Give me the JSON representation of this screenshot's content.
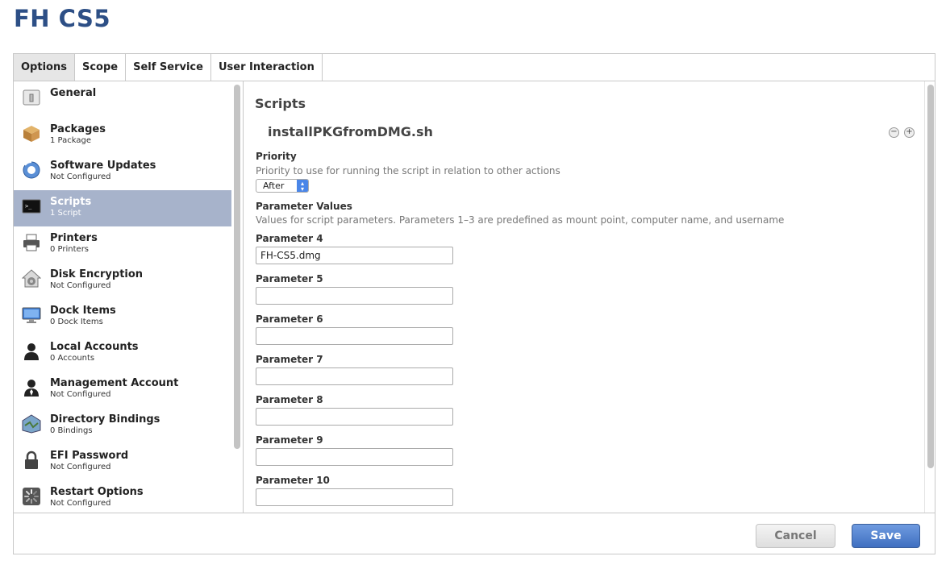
{
  "page": {
    "title": "FH CS5"
  },
  "tabs": [
    {
      "label": "Options",
      "active": true
    },
    {
      "label": "Scope"
    },
    {
      "label": "Self Service"
    },
    {
      "label": "User Interaction"
    }
  ],
  "sidebar": {
    "items": [
      {
        "name": "General",
        "sub": "",
        "icon": "general-icon"
      },
      {
        "name": "Packages",
        "sub": "1 Package",
        "icon": "package-icon"
      },
      {
        "name": "Software Updates",
        "sub": "Not Configured",
        "icon": "software-update-icon"
      },
      {
        "name": "Scripts",
        "sub": "1 Script",
        "icon": "terminal-icon",
        "active": true
      },
      {
        "name": "Printers",
        "sub": "0 Printers",
        "icon": "printer-icon"
      },
      {
        "name": "Disk Encryption",
        "sub": "Not Configured",
        "icon": "disk-encryption-icon"
      },
      {
        "name": "Dock Items",
        "sub": "0 Dock Items",
        "icon": "monitor-icon"
      },
      {
        "name": "Local Accounts",
        "sub": "0 Accounts",
        "icon": "user-icon"
      },
      {
        "name": "Management Account",
        "sub": "Not Configured",
        "icon": "admin-user-icon"
      },
      {
        "name": "Directory Bindings",
        "sub": "0 Bindings",
        "icon": "directory-icon"
      },
      {
        "name": "EFI Password",
        "sub": "Not Configured",
        "icon": "lock-icon"
      },
      {
        "name": "Restart Options",
        "sub": "Not Configured",
        "icon": "restart-icon"
      }
    ]
  },
  "main": {
    "section_title": "Scripts",
    "script_name": "installPKGfromDMG.sh",
    "priority": {
      "label": "Priority",
      "hint": "Priority to use for running the script in relation to other actions",
      "value": "After"
    },
    "parameters": {
      "label": "Parameter Values",
      "hint": "Values for script parameters. Parameters 1–3 are predefined as mount point, computer name, and username",
      "fields": [
        {
          "label": "Parameter 4",
          "value": "FH-CS5.dmg"
        },
        {
          "label": "Parameter 5",
          "value": ""
        },
        {
          "label": "Parameter 6",
          "value": ""
        },
        {
          "label": "Parameter 7",
          "value": ""
        },
        {
          "label": "Parameter 8",
          "value": ""
        },
        {
          "label": "Parameter 9",
          "value": ""
        },
        {
          "label": "Parameter 10",
          "value": ""
        }
      ]
    }
  },
  "footer": {
    "cancel_label": "Cancel",
    "save_label": "Save"
  },
  "colors": {
    "title": "#2d4f86",
    "active_item": "#a7b3cb",
    "save_button": "#4f7fcf"
  }
}
